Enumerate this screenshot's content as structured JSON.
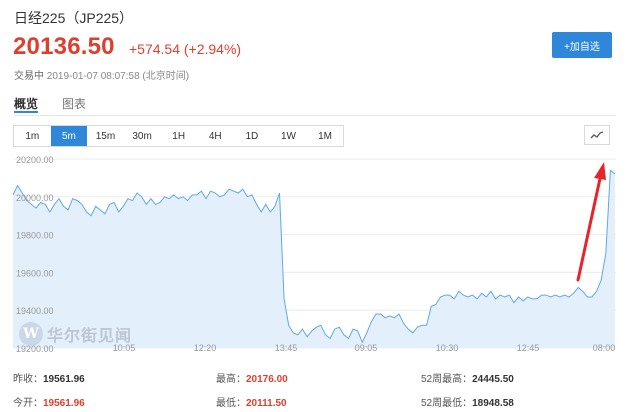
{
  "header": {
    "title": "日经225（JP225）",
    "price": "20136.50",
    "change": "+574.54 (+2.94%)",
    "status_label": "交易中",
    "timestamp": "2019-01-07 08:07:58",
    "timezone": "(北京时间)",
    "add_button_label": "+加自选"
  },
  "tabs": [
    {
      "label": "概览"
    },
    {
      "label": "图表"
    }
  ],
  "intervals": [
    "1m",
    "5m",
    "15m",
    "30m",
    "1H",
    "4H",
    "1D",
    "1W",
    "1M"
  ],
  "selected_interval": "5m",
  "chart_type_icon": "line-chart-icon",
  "watermark": {
    "logo_letter": "W",
    "text": "华尔街见闻"
  },
  "colors": {
    "accent": "#2e87d8",
    "up": "#e03e2d",
    "line": "#62a7e6",
    "fill": "#e3f0fc",
    "annotation_arrow": "#e8242b"
  },
  "chart_data": {
    "type": "area",
    "yticks": [
      "20200.00",
      "20000.00",
      "19800.00",
      "19600.00",
      "19400.00",
      "19200.00"
    ],
    "ylim": [
      19200,
      20200
    ],
    "xticks": [
      "10:05",
      "12:20",
      "13:45",
      "09:05",
      "10:30",
      "12:45",
      "08:00"
    ],
    "series": [
      {
        "values": [
          20010,
          20060,
          20020,
          19980,
          19960,
          19940,
          19970,
          19960,
          19920,
          19960,
          19990,
          19950,
          19930,
          19990,
          19980,
          19960,
          19920,
          19900,
          19950,
          19930,
          19910,
          19960,
          19970,
          19920,
          19950,
          19990,
          19980,
          20020,
          20000,
          19960,
          19990,
          19960,
          19970,
          20000,
          19990,
          20010,
          19990,
          20000,
          19980,
          20010,
          20010,
          20030,
          19990,
          20030,
          20020,
          20000,
          20010,
          20040,
          20030,
          20020,
          20040,
          20000,
          20010,
          19960,
          19920,
          19960,
          19920,
          19950,
          20020,
          19460,
          19320,
          19280,
          19270,
          19300,
          19260,
          19290,
          19310,
          19320,
          19270,
          19250,
          19300,
          19310,
          19270,
          19250,
          19300,
          19290,
          19230,
          19280,
          19340,
          19380,
          19380,
          19360,
          19370,
          19360,
          19380,
          19330,
          19300,
          19280,
          19310,
          19320,
          19320,
          19420,
          19430,
          19470,
          19480,
          19480,
          19460,
          19500,
          19480,
          19470,
          19480,
          19460,
          19490,
          19470,
          19500,
          19460,
          19480,
          19470,
          19480,
          19440,
          19470,
          19450,
          19470,
          19460,
          19460,
          19480,
          19480,
          19470,
          19480,
          19470,
          19480,
          19470,
          19490,
          19520,
          19500,
          19470,
          19470,
          19500,
          19560,
          19700,
          20140,
          20120
        ]
      }
    ]
  },
  "stats": [
    {
      "label": "昨收：",
      "value": "19561.96",
      "red": false
    },
    {
      "label": "最高：",
      "value": "20176.00",
      "red": true
    },
    {
      "label": "52周最高：",
      "value": "24445.50",
      "red": false
    },
    {
      "label": "今开：",
      "value": "19561.96",
      "red": true
    },
    {
      "label": "最低：",
      "value": "20111.50",
      "red": true
    },
    {
      "label": "52周最低：",
      "value": "18948.58",
      "red": false
    }
  ]
}
